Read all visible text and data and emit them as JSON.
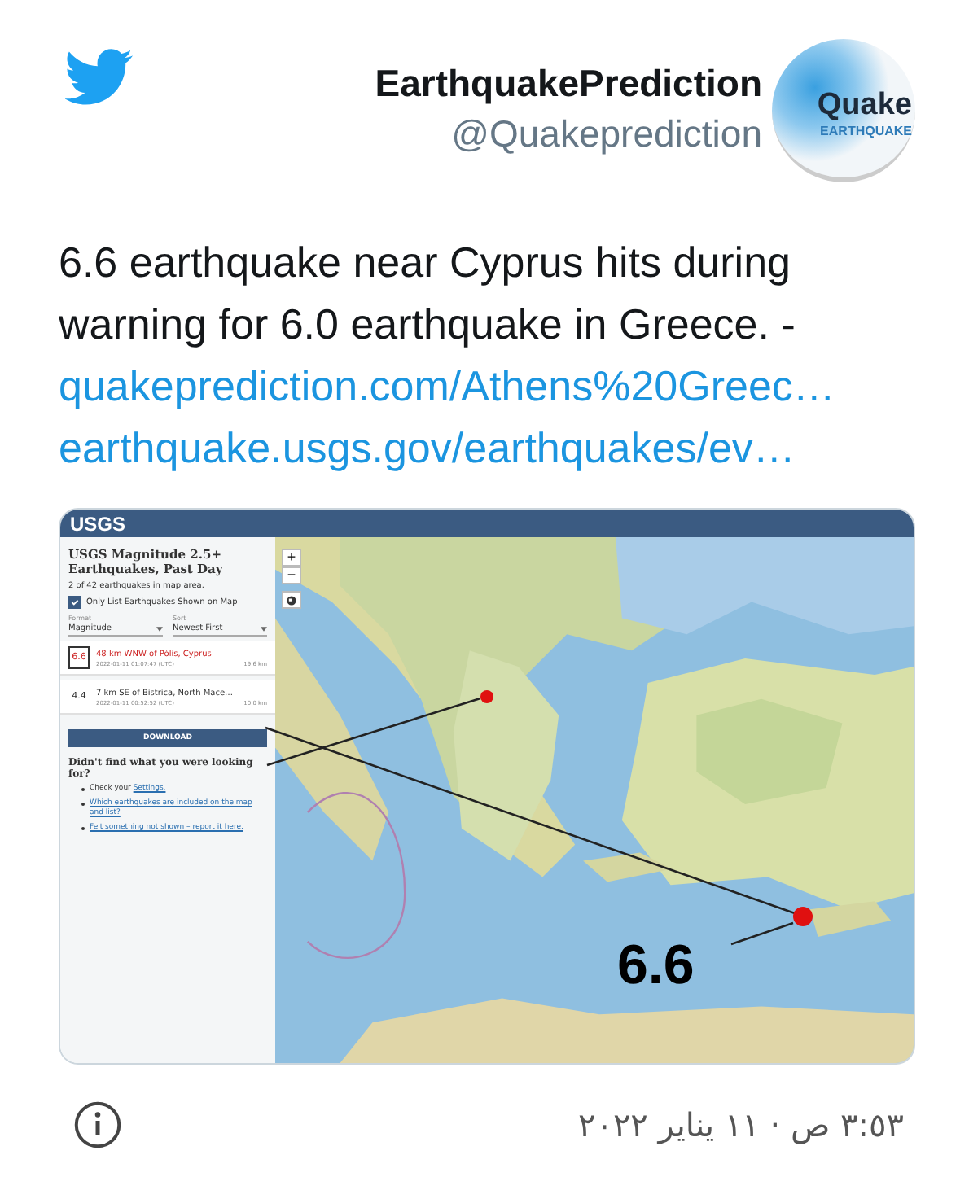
{
  "account": {
    "name": "EarthquakePrediction",
    "handle": "@Quakeprediction",
    "avatar": {
      "wordmark": "Quake",
      "tagline": "EARTHQUAKE"
    }
  },
  "tweet": {
    "text": "6.6 earthquake near Cyprus hits during warning for 6.0 earthquake in Greece.  -",
    "links": [
      "quakeprediction.com/Athens%20Greec…",
      "earthquake.usgs.gov/earthquakes/ev…"
    ]
  },
  "embed": {
    "logo": "USGS",
    "panel": {
      "title": "USGS Magnitude 2.5+ Earthquakes, Past Day",
      "count": "2 of 42 earthquakes in map area.",
      "filter": {
        "label": "Only List Earthquakes Shown on Map",
        "checked": true
      },
      "selects": [
        {
          "label": "Format",
          "value": "Magnitude"
        },
        {
          "label": "Sort",
          "value": "Newest First"
        }
      ],
      "quakes": [
        {
          "mag": "6.6",
          "place": "48 km WNW of Pólis, Cyprus",
          "time": "2022-01-11 01:07:47 (UTC)",
          "depth": "19.6 km",
          "selected": true
        },
        {
          "mag": "4.4",
          "place": "7 km SE of Bistrica, North Mace…",
          "time": "2022-01-11 00:52:52 (UTC)",
          "depth": "10.0 km",
          "selected": false
        }
      ],
      "download": "DOWNLOAD",
      "help_title": "Didn't find what you were looking for?",
      "help_items": [
        {
          "text": "Check your ",
          "link": "Settings."
        },
        {
          "link": "Which earthquakes are included on the map and list?"
        },
        {
          "link": "Felt something not shown – report it here."
        }
      ]
    },
    "map": {
      "kind": "picture",
      "zoom_in": "+",
      "zoom_out": "−",
      "annotation": "6.6"
    }
  },
  "timestamp": "٣:٥٣ ص · ١١ يناير ٢٠٢٢"
}
